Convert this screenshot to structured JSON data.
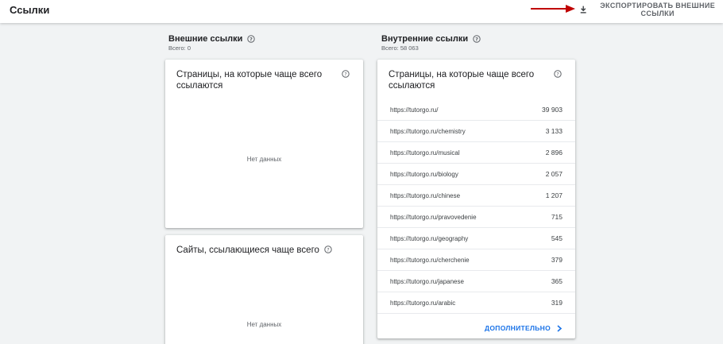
{
  "header": {
    "title": "Ссылки",
    "export_label": "ЭКСПОРТИРОВАТЬ ВНЕШНИЕ ССЫЛКИ"
  },
  "external": {
    "title": "Внешние ссылки",
    "total": "Всего: 0",
    "top_pages": {
      "title": "Страницы, на которые чаще всего ссылаются",
      "empty": "Нет данных"
    },
    "top_sites": {
      "title": "Сайты, ссылающиеся чаще всего",
      "empty": "Нет данных"
    }
  },
  "internal": {
    "title": "Внутренние ссылки",
    "total": "Всего: 58 063",
    "top_pages": {
      "title": "Страницы, на которые чаще всего ссылаются",
      "rows": [
        {
          "url": "https://tutorgo.ru/",
          "value": "39 903"
        },
        {
          "url": "https://tutorgo.ru/chemistry",
          "value": "3 133"
        },
        {
          "url": "https://tutorgo.ru/musical",
          "value": "2 896"
        },
        {
          "url": "https://tutorgo.ru/biology",
          "value": "2 057"
        },
        {
          "url": "https://tutorgo.ru/chinese",
          "value": "1 207"
        },
        {
          "url": "https://tutorgo.ru/pravovedenie",
          "value": "715"
        },
        {
          "url": "https://tutorgo.ru/geography",
          "value": "545"
        },
        {
          "url": "https://tutorgo.ru/cherchenie",
          "value": "379"
        },
        {
          "url": "https://tutorgo.ru/japanese",
          "value": "365"
        },
        {
          "url": "https://tutorgo.ru/arabic",
          "value": "319"
        }
      ],
      "more_label": "ДОПОЛНИТЕЛЬНО"
    }
  },
  "colors": {
    "accent": "#1a73e8",
    "annotation_arrow": "#c00000"
  },
  "icons": [
    "download-icon",
    "help-icon",
    "chevron-right-icon",
    "red-arrow-annotation"
  ]
}
